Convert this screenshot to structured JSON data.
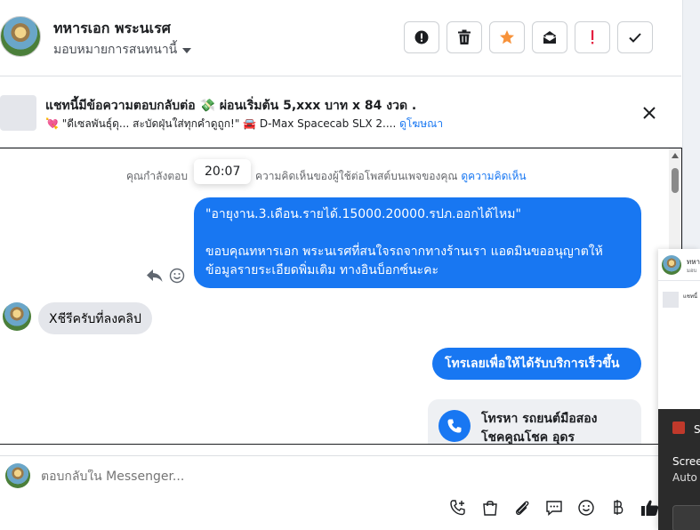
{
  "header": {
    "contact_name": "ทหารเอก พระนเรศ",
    "assign_label": "มอบหมายการสนทนานี้",
    "toolbar": {
      "spam_label": "ทำเครื่องหมายว่าเป็นสแปม",
      "delete_label": "ลบ",
      "star_label": "ติดดาว",
      "unread_label": "ทำเครื่องหมายว่ายังไม่ได้อ่าน",
      "follow_up_label": "ติดตาม",
      "done_label": "เสร็จสิ้น"
    },
    "colors": {
      "star": "#f7923a",
      "follow_up": "#e41e3f"
    }
  },
  "ad_bar": {
    "title": "แชทนี้มีข้อความตอบกลับต่อ 💸 ผ่อนเริ่มต้น 5,xxx บาท x 84 งวด .",
    "subtitle": "💘 \"ดีเซลพันธุ์ดุ... สะบัดฝุ่นใส่ทุกคำดูถูก!\" 🚘 D-Max Spacecab SLX 2....",
    "link": "ดูโฆษณา"
  },
  "chat": {
    "tooltip_time": "20:07",
    "notice_text": "คุณกำลังตอบ",
    "notice_text_after": "ความคิดเห็นของผู้ใช้ต่อโพสต์บนเพจของคุณ",
    "notice_link": "ดูความคิดเห็น",
    "outgoing_1": {
      "line1": "\"อายุงาน.3.เดือน.รายได้.15000.20000.รปภ.ออกได้ไหม\"",
      "line2": "ขอบคุณทหารเอก พระนเรศที่สนใจรถจากทางร้านเรา แอดมินขออนุญาตให้",
      "line3": "ข้อมูลรายระเอียดพิ่มเติม ทางอินบ็อกซ์นะคะ"
    },
    "incoming_1": "Xชีรีครับที่ลงคลิป",
    "outgoing_2": "โทรเลยเพื่อให้ได้รับบริการเร็วขึ้น",
    "call_card": {
      "line1": "โทรหา รถยนต์มือสอง",
      "line2": "โชคคูณโชค อุดร"
    },
    "colors": {
      "outgoing": "#1877f2",
      "incoming": "#e4e6eb"
    }
  },
  "composer": {
    "placeholder": "ตอบกลับใน Messenger..."
  },
  "side_panel": {
    "title": "ทหา",
    "subtitle": "มอบ",
    "ad_text": "แชทนี้",
    "dark_title": "S",
    "dark_line1": "Scree",
    "dark_line2": "Auto"
  }
}
